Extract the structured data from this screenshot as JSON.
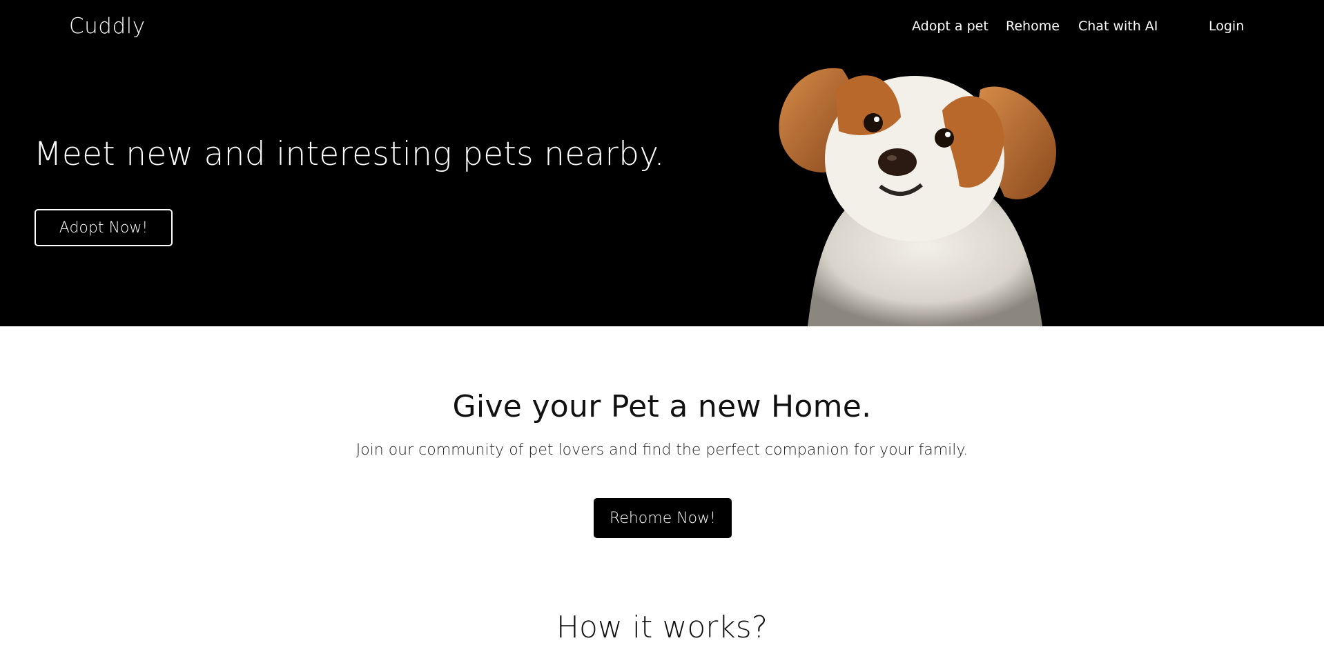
{
  "header": {
    "brand": "Cuddly",
    "nav": {
      "adopt": "Adopt a pet",
      "rehome": "Rehome",
      "chat": "Chat with AI",
      "login": "Login"
    }
  },
  "hero": {
    "title": "Meet new and interesting pets nearby.",
    "cta": "Adopt Now!",
    "background_color": "#000000"
  },
  "rehome_section": {
    "title": "Give your Pet a new Home.",
    "subtitle": "Join our community of pet lovers and find the perfect companion for your family.",
    "cta": "Rehome Now!"
  },
  "how_section": {
    "title": "How it works?"
  }
}
